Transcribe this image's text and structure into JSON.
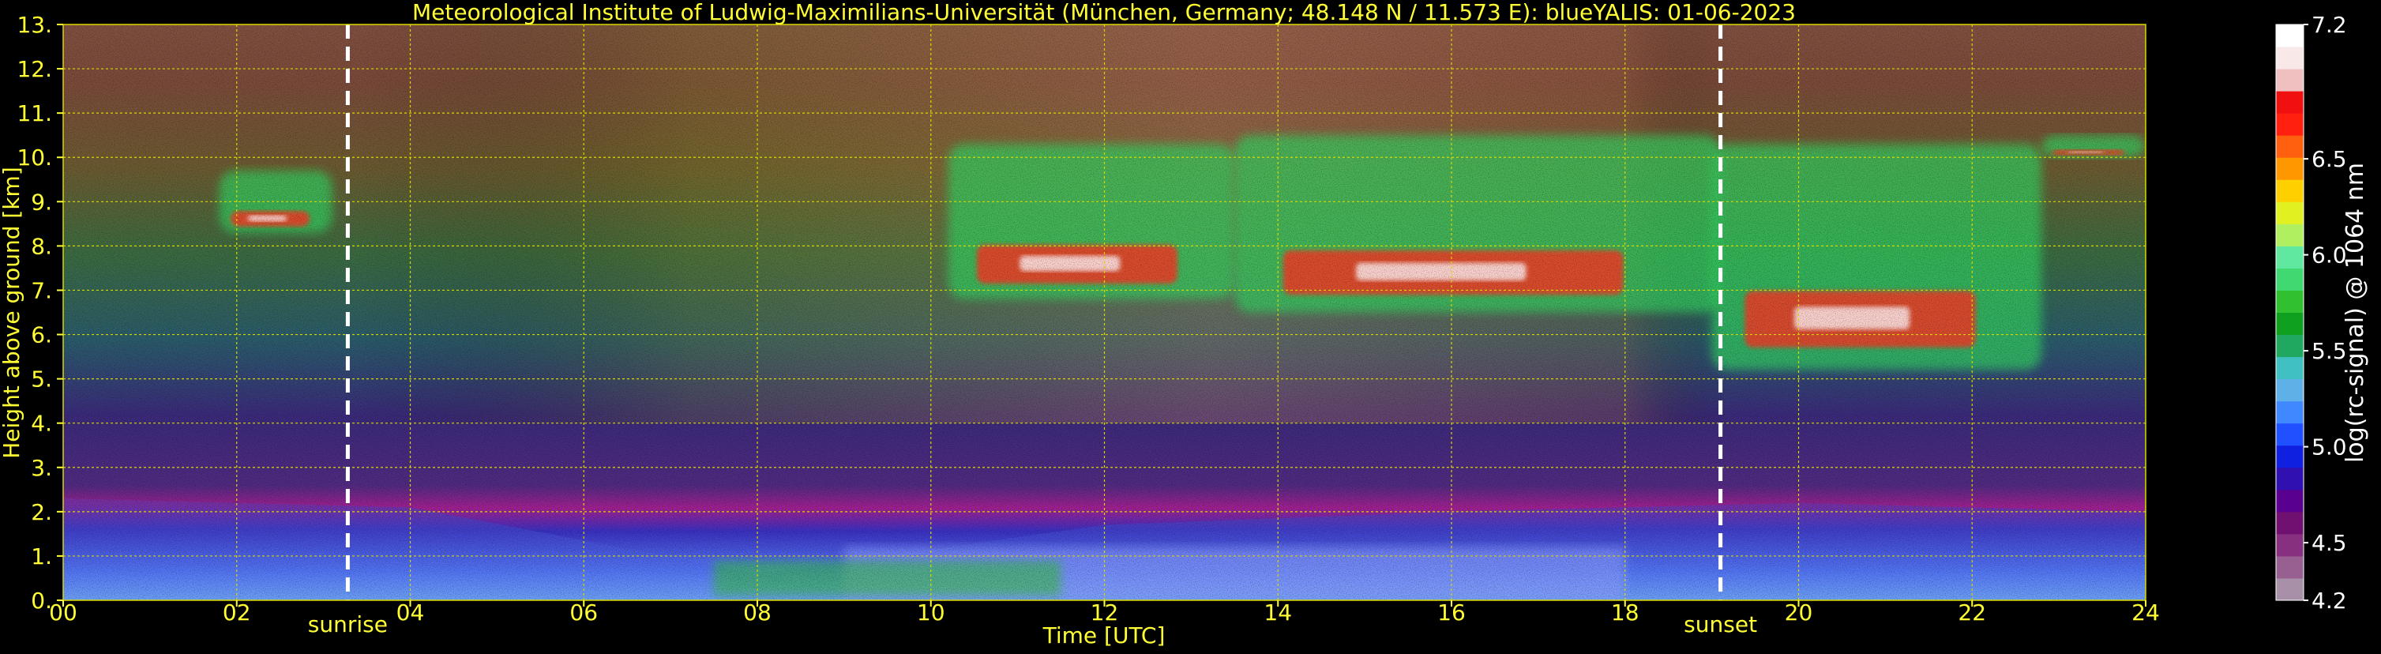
{
  "colors": {
    "background": "#000000",
    "text": "#ffff33",
    "grid": "#d8d800",
    "marker": "#ffffff",
    "colorbar_text": "#ffffff"
  },
  "chart_data": {
    "type": "heatmap",
    "title": "Meteorological Institute of Ludwig-Maximilians-Universität (München, Germany; 48.148 N / 11.573 E):    blueYALIS: 01-06-2023",
    "xlabel": "Time [UTC]",
    "ylabel": "Height above ground [km]",
    "xlim": [
      0,
      24
    ],
    "ylim": [
      0,
      13
    ],
    "grid": true,
    "x_ticks": [
      0,
      2,
      4,
      6,
      8,
      10,
      12,
      14,
      16,
      18,
      20,
      22,
      24
    ],
    "x_tick_labels": [
      "00",
      "02",
      "04",
      "06",
      "08",
      "10",
      "12",
      "14",
      "16",
      "18",
      "20",
      "22",
      "24"
    ],
    "y_ticks": [
      0,
      1,
      2,
      3,
      4,
      5,
      6,
      7,
      8,
      9,
      10,
      11,
      12,
      13
    ],
    "y_tick_labels": [
      "0.",
      "1.",
      "2.",
      "3.",
      "4.",
      "5.",
      "6.",
      "7.",
      "8.",
      "9.",
      "10.",
      "11.",
      "12.",
      "13."
    ],
    "markers": [
      {
        "label": "sunrise",
        "x": 3.28
      },
      {
        "label": "sunset",
        "x": 19.1
      }
    ],
    "colorbar": {
      "label": "log(rc-signal) @ 1064 nm",
      "range": [
        4.2,
        7.2
      ],
      "ticks": [
        4.2,
        4.5,
        5.0,
        5.5,
        6.0,
        6.5,
        7.2
      ],
      "tick_labels": [
        "4.2",
        "4.5",
        "5.0",
        "5.5",
        "6.0",
        "6.5",
        "7.2"
      ],
      "colors": [
        "#a890a8",
        "#986090",
        "#883080",
        "#701070",
        "#5a0090",
        "#3010b0",
        "#1020e0",
        "#2050ff",
        "#4088ff",
        "#60b0e8",
        "#40c0c0",
        "#20a860",
        "#10a020",
        "#30c030",
        "#40d870",
        "#60e8a0",
        "#b0f060",
        "#e0f020",
        "#ffd000",
        "#ff9800",
        "#ff6010",
        "#ff2010",
        "#f01010",
        "#f0c0c0",
        "#f8e8e8",
        "#ffffff"
      ]
    },
    "cloud_layers": [
      {
        "start": 1.8,
        "end": 3.1,
        "base": 8.3,
        "top": 9.7
      },
      {
        "start": 10.2,
        "end": 13.5,
        "base": 6.8,
        "top": 10.3
      },
      {
        "start": 13.5,
        "end": 19.1,
        "base": 6.5,
        "top": 10.5
      },
      {
        "start": 19.0,
        "end": 22.8,
        "base": 5.2,
        "top": 10.3
      },
      {
        "start": 22.8,
        "end": 24.0,
        "base": 10.0,
        "top": 10.5
      }
    ],
    "boundary_layer_top_km": [
      {
        "x": 0,
        "y": 2.3
      },
      {
        "x": 4,
        "y": 2.1
      },
      {
        "x": 8,
        "y": 0.6
      },
      {
        "x": 12,
        "y": 1.7
      },
      {
        "x": 16,
        "y": 2.0
      },
      {
        "x": 20,
        "y": 2.2
      },
      {
        "x": 24,
        "y": 2.0
      }
    ]
  }
}
